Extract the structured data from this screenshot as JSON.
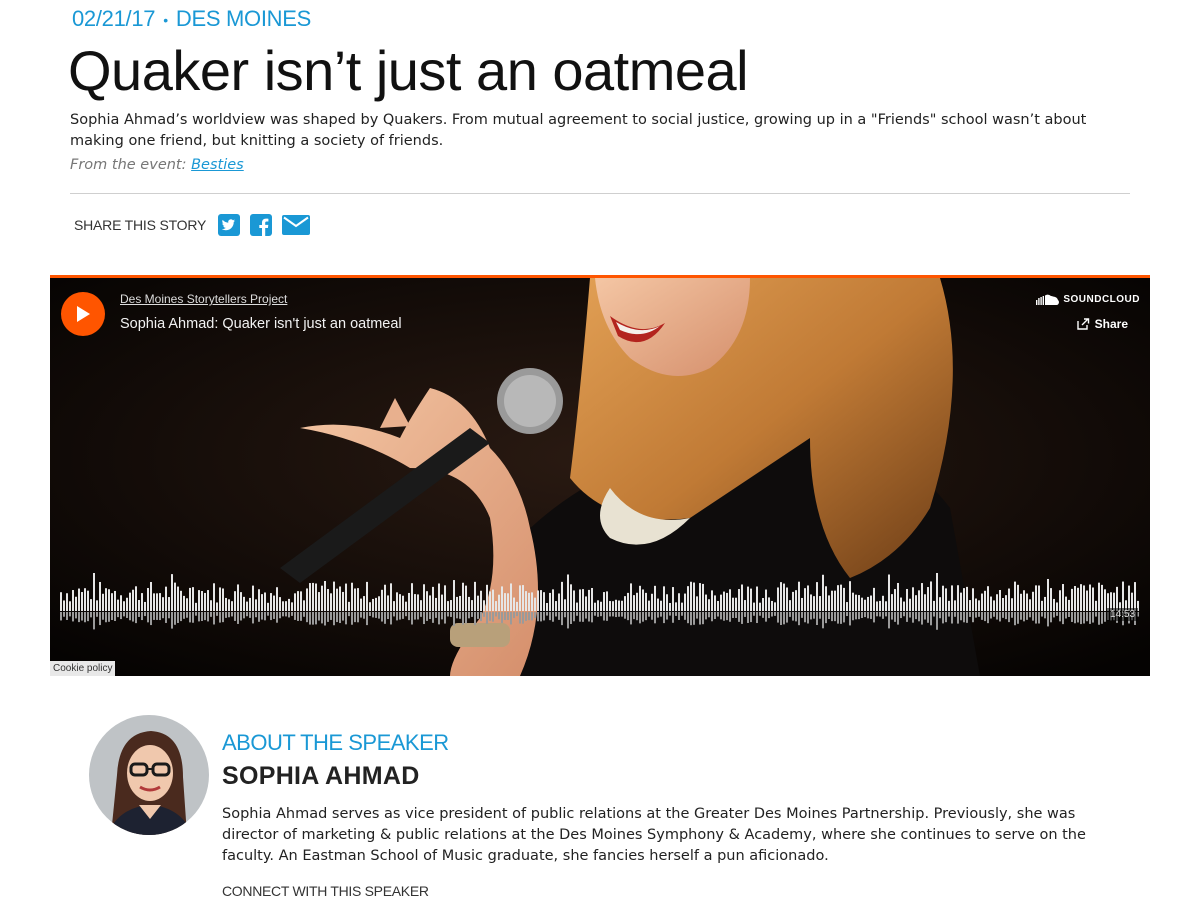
{
  "article": {
    "date": "02/21/17",
    "separator": "•",
    "location": "DES MOINES",
    "title": "Quaker isn’t just an oatmeal",
    "summary": "Sophia Ahmad’s worldview was shaped by Quakers. From mutual agreement to social justice, growing up in a \"Friends\" school wasn’t about making one friend, but knitting a society of friends.",
    "from_event_prefix": "From the event:",
    "event_name": "Besties"
  },
  "share": {
    "label": "SHARE THIS STORY",
    "icons": [
      "twitter-icon",
      "facebook-icon",
      "email-icon"
    ]
  },
  "player": {
    "uploader": "Des Moines Storytellers Project",
    "track_title": "Sophia Ahmad: Quaker isn't just an oatmeal",
    "brand": "SOUNDCLOUD",
    "share_label": "Share",
    "duration": "14:53",
    "cookie_policy": "Cookie policy",
    "accent_color": "#ff5500"
  },
  "speaker": {
    "section_label": "ABOUT THE SPEAKER",
    "name": "SOPHIA AHMAD",
    "bio": "Sophia Ahmad serves as vice president of public relations at the Greater Des Moines Partnership. Previously, she was director of marketing & public relations at the Des Moines Symphony & Academy, where she continues to serve on the faculty. An Eastman School of Music graduate, she fancies herself a pun aficionado.",
    "connect_label": "CONNECT WITH THIS SPEAKER"
  },
  "colors": {
    "link_blue": "#1a98d5",
    "soundcloud_orange": "#ff5500"
  }
}
